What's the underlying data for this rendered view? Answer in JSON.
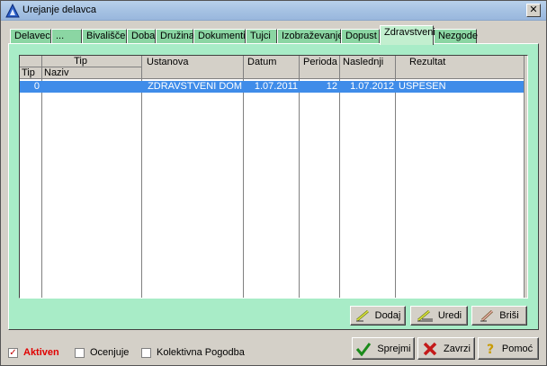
{
  "window": {
    "title": "Urejanje delavca"
  },
  "tabs": [
    {
      "label": "Delavec"
    },
    {
      "label": "..."
    },
    {
      "label": "Bivališče"
    },
    {
      "label": "Doba"
    },
    {
      "label": "Družina"
    },
    {
      "label": "Dokumenti"
    },
    {
      "label": "Tujci"
    },
    {
      "label": "Izobraževanje"
    },
    {
      "label": "Dopust"
    },
    {
      "label": "Zdravstveni"
    },
    {
      "label": "Nezgode"
    }
  ],
  "active_tab": "Zdravstveni",
  "grid": {
    "group_header": "Tip",
    "columns": {
      "tip": "Tip",
      "naziv": "Naziv",
      "ustanova": "Ustanova",
      "datum": "Datum",
      "perioda": "Perioda",
      "naslednji": "Naslednji",
      "rezultat": "Rezultat"
    },
    "rows": [
      {
        "tip": "0",
        "naziv": "",
        "ustanova": "ZDRAVSTVENI DOM",
        "datum": "1.07.2011",
        "perioda": "12",
        "naslednji": "1.07.2012",
        "rezultat": "USPESEN"
      }
    ]
  },
  "grid_buttons": {
    "add": "Dodaj",
    "edit": "Uredi",
    "delete": "Briši"
  },
  "checkboxes": [
    {
      "label": "Aktiven",
      "checked": true,
      "color": "#ff0000"
    },
    {
      "label": "Ocenjuje",
      "checked": false
    },
    {
      "label": "Kolektivna Pogodba",
      "checked": false
    }
  ],
  "footer_buttons": {
    "accept": "Sprejmi",
    "cancel": "Zavrzi",
    "help": "Pomoć"
  },
  "colors": {
    "tab": "#8bd6a3",
    "page": "#a8ecc7",
    "selected_row": "#3f8ce9"
  }
}
